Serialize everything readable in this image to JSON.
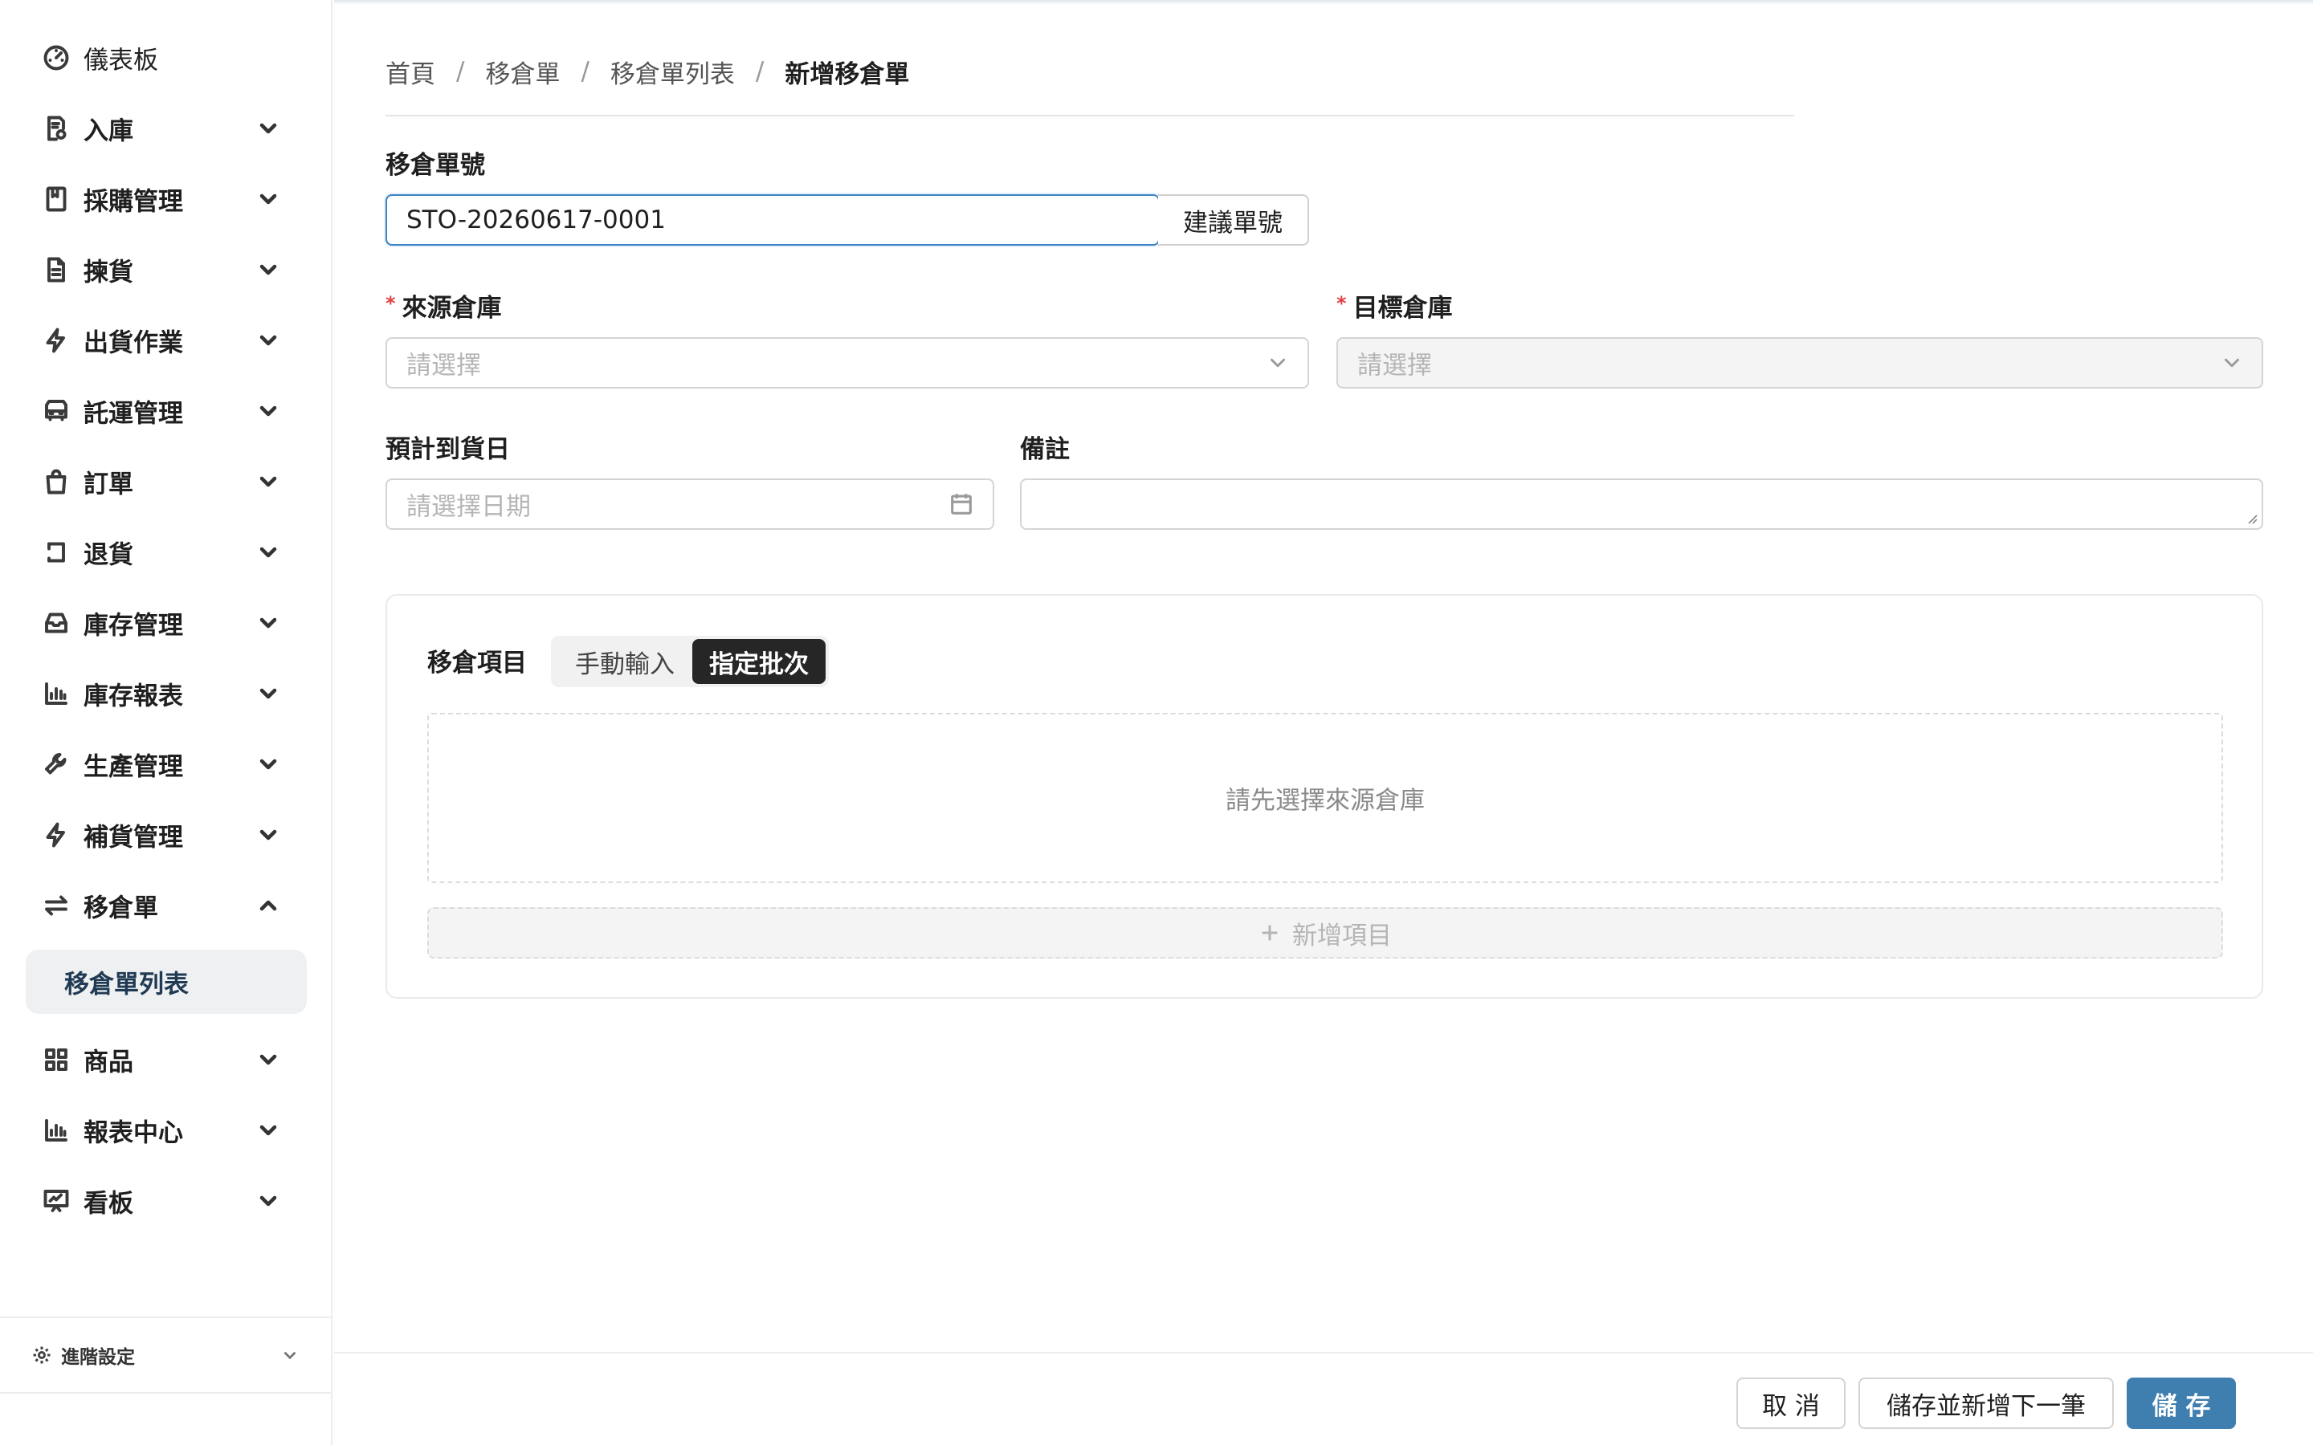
{
  "sidebar": {
    "items": [
      {
        "label": "儀表板",
        "icon": "dashboard-icon"
      },
      {
        "label": "入庫",
        "icon": "inbound-icon"
      },
      {
        "label": "採購管理",
        "icon": "book-icon"
      },
      {
        "label": "揀貨",
        "icon": "document-icon"
      },
      {
        "label": "出貨作業",
        "icon": "lightning-icon"
      },
      {
        "label": "託運管理",
        "icon": "truck-icon"
      },
      {
        "label": "訂單",
        "icon": "bag-icon"
      },
      {
        "label": "退貨",
        "icon": "return-icon"
      },
      {
        "label": "庫存管理",
        "icon": "inbox-icon"
      },
      {
        "label": "庫存報表",
        "icon": "bar-chart-icon"
      },
      {
        "label": "生產管理",
        "icon": "wrench-icon"
      },
      {
        "label": "補貨管理",
        "icon": "lightning-icon"
      },
      {
        "label": "移倉單",
        "icon": "transfer-icon"
      },
      {
        "label": "商品",
        "icon": "grid-icon"
      },
      {
        "label": "報表中心",
        "icon": "bar-chart-icon"
      },
      {
        "label": "看板",
        "icon": "presentation-icon"
      }
    ],
    "active_sub": "移倉單列表",
    "footer_label": "進階設定"
  },
  "breadcrumb": {
    "items": [
      "首頁",
      "移倉單",
      "移倉單列表",
      "新增移倉單"
    ]
  },
  "form": {
    "order_no_label": "移倉單號",
    "order_no_value": "STO-20260617-0001",
    "suggest_button": "建議單號",
    "source_label": "來源倉庫",
    "source_placeholder": "請選擇",
    "target_label": "目標倉庫",
    "target_placeholder": "請選擇",
    "eta_label": "預計到貨日",
    "eta_placeholder": "請選擇日期",
    "note_label": "備註",
    "note_value": ""
  },
  "items_card": {
    "title": "移倉項目",
    "modes": [
      "手動輸入",
      "指定批次"
    ],
    "active_mode": "指定批次",
    "empty_text": "請先選擇來源倉庫",
    "add_label": "新增項目"
  },
  "footer": {
    "cancel": "取 消",
    "save_next": "儲存並新增下一筆",
    "save": "儲 存"
  },
  "colors": {
    "primary": "#3f7fb0",
    "focus": "#3b82c4",
    "required": "#e04040",
    "active_sub_bg": "#eef0f2",
    "segment_active": "#262626"
  }
}
